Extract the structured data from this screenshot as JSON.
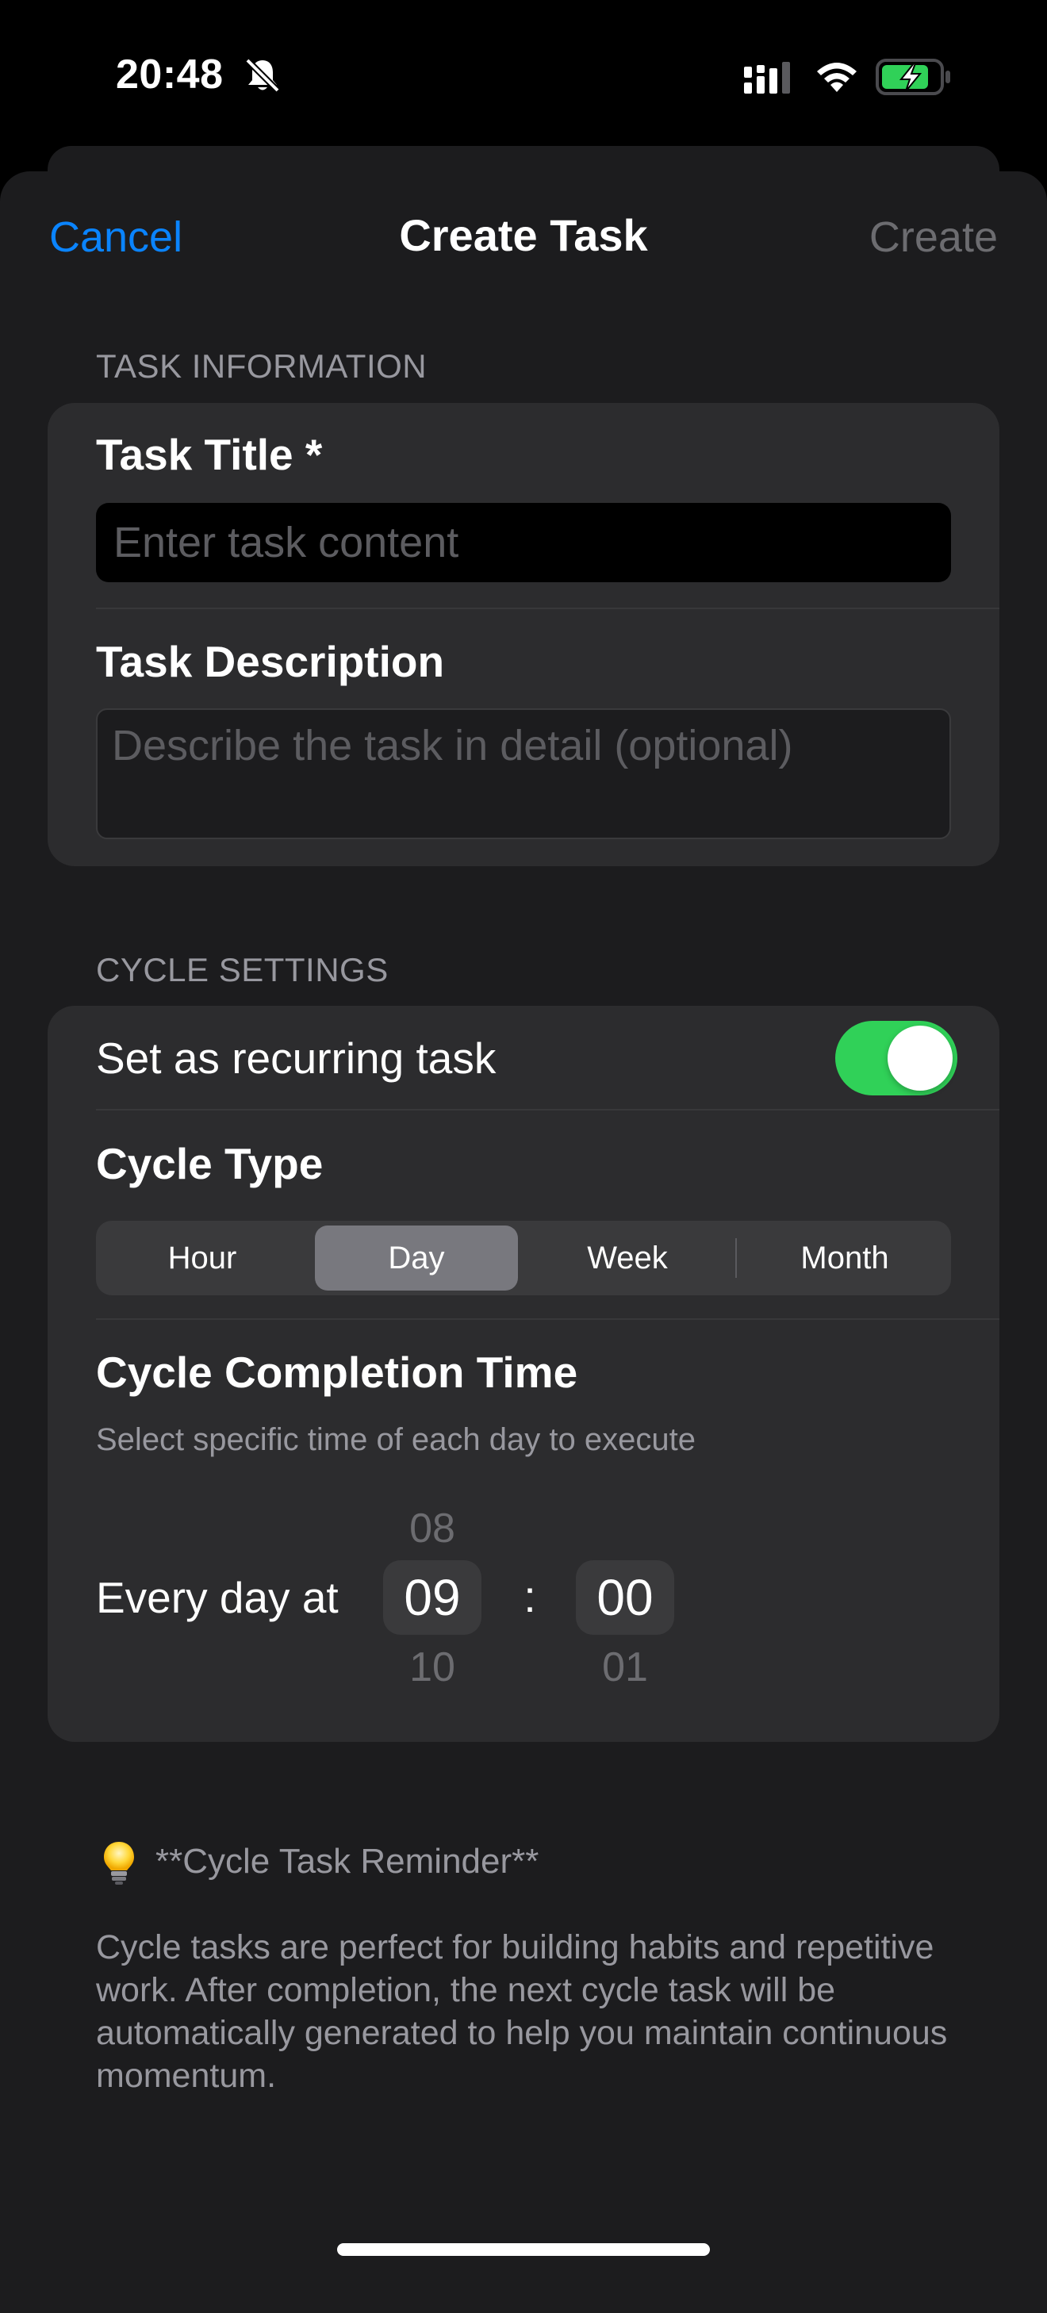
{
  "status_bar": {
    "time": "20:48",
    "icons": [
      "bell-slash-icon",
      "cellular-signal-icon",
      "wifi-icon",
      "battery-charging-icon"
    ],
    "battery_color": "#30d158"
  },
  "nav": {
    "cancel_label": "Cancel",
    "title": "Create Task",
    "create_label": "Create"
  },
  "task_information": {
    "header": "TASK INFORMATION",
    "title_label": "Task Title *",
    "title_placeholder": "Enter task content",
    "title_value": "",
    "description_label": "Task Description",
    "description_placeholder": "Describe the task in detail (optional)",
    "description_value": ""
  },
  "cycle_settings": {
    "header": "CYCLE SETTINGS",
    "recurring_label": "Set as recurring task",
    "recurring_enabled": true,
    "cycle_type_label": "Cycle Type",
    "cycle_types": [
      "Hour",
      "Day",
      "Week",
      "Month"
    ],
    "selected_cycle_type": "Day",
    "completion_time_label": "Cycle Completion Time",
    "completion_time_hint": "Select specific time of each day to execute",
    "every_day_label": "Every day at",
    "hour_picker": {
      "previous": "08",
      "selected": "09",
      "next": "10"
    },
    "time_separator": ":",
    "minute_picker": {
      "previous": "",
      "selected": "00",
      "next": "01"
    }
  },
  "reminder": {
    "icon": "lightbulb-icon",
    "title": "**Cycle Task Reminder**",
    "body": "Cycle tasks are perfect for building habits and repetitive work. After completion, the next cycle task will be automatically generated to help you maintain continuous momentum."
  },
  "colors": {
    "accent": "#0a84ff",
    "toggle_on": "#30d158",
    "background": "#1c1c1e",
    "card": "#2c2c2e"
  }
}
